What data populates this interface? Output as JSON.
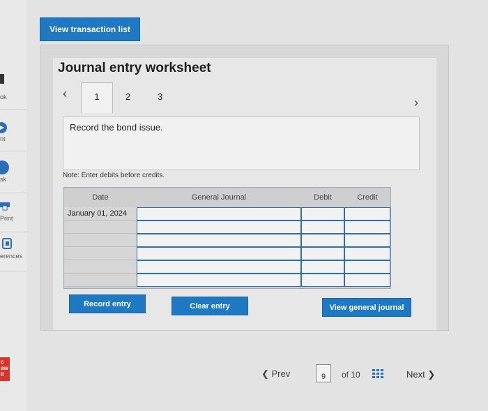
{
  "sidebar": {
    "items": [
      {
        "label": "ok",
        "icon": "book-icon"
      },
      {
        "label": "nt",
        "icon": "hint-icon"
      },
      {
        "label": "sk",
        "icon": "ask-icon"
      },
      {
        "label": "Print",
        "icon": "print-icon"
      },
      {
        "label": "erences",
        "icon": "references-icon"
      }
    ],
    "bottom_badge": {
      "line1": "c",
      "line2": "aw",
      "line3": "II"
    }
  },
  "toolbar": {
    "view_transactions_label": "View transaction list"
  },
  "worksheet": {
    "title": "Journal entry worksheet",
    "tabs": [
      "1",
      "2",
      "3"
    ],
    "active_tab": "1",
    "instruction": "Record the bond issue.",
    "note": "Note: Enter debits before credits.",
    "columns": {
      "date": "Date",
      "general_journal": "General Journal",
      "debit": "Debit",
      "credit": "Credit"
    },
    "rows": [
      {
        "date": "January 01, 2024",
        "account": "",
        "debit": "",
        "credit": ""
      },
      {
        "date": "",
        "account": "",
        "debit": "",
        "credit": ""
      },
      {
        "date": "",
        "account": "",
        "debit": "",
        "credit": ""
      },
      {
        "date": "",
        "account": "",
        "debit": "",
        "credit": ""
      },
      {
        "date": "",
        "account": "",
        "debit": "",
        "credit": ""
      },
      {
        "date": "",
        "account": "",
        "debit": "",
        "credit": ""
      }
    ],
    "buttons": {
      "record": "Record entry",
      "clear": "Clear entry",
      "view_gj": "View general journal"
    }
  },
  "pagination": {
    "prev": "Prev",
    "current_page": "9",
    "of_total": "of 10",
    "next": "Next"
  },
  "colors": {
    "accent": "#1e78c2",
    "field_border": "#2d6db1"
  }
}
